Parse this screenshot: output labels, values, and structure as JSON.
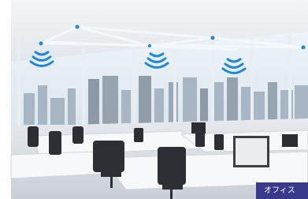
{
  "photo": {
    "subject": "office-interior-with-wireless-ceiling-lights",
    "colors": {
      "sky": "#dfeaf1",
      "city": "#9fb0bc",
      "light_beam": "#eef5fa",
      "wifi_signal": "#1e88d8",
      "desk": "#f4f6f8",
      "chair": "#2c2f33",
      "floor": "#d8dde2",
      "tag_background": "#3a3a8c"
    },
    "icons": [
      "wifi-signal-icon",
      "wifi-signal-icon",
      "wifi-signal-icon"
    ]
  },
  "tag": {
    "label": "オフィス"
  }
}
